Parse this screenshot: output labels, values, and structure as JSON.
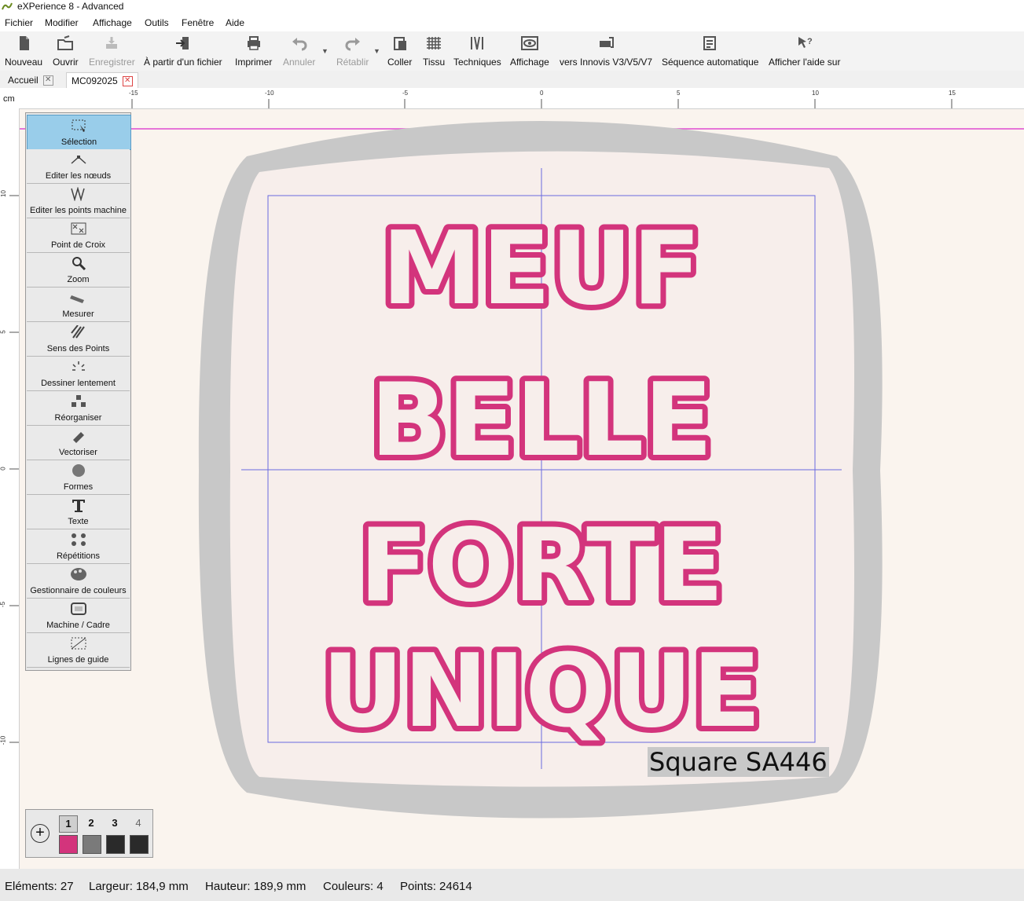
{
  "app": {
    "title": "eXPerience 8 - Advanced"
  },
  "menu": [
    "Fichier",
    "Modifier",
    "Affichage",
    "Outils",
    "Fenêtre",
    "Aide"
  ],
  "toolbar": [
    {
      "label": "Nouveau",
      "icon": "new-file-icon",
      "enabled": true
    },
    {
      "label": "Ouvrir",
      "icon": "open-folder-icon",
      "enabled": true
    },
    {
      "label": "Enregistrer",
      "icon": "save-icon",
      "enabled": false
    },
    {
      "label": "À partir d'un fichier",
      "icon": "import-file-icon",
      "enabled": true
    },
    {
      "label": "Imprimer",
      "icon": "printer-icon",
      "enabled": true
    },
    {
      "label": "Annuler",
      "icon": "undo-icon",
      "enabled": false
    },
    {
      "label": "Rétablir",
      "icon": "redo-icon",
      "enabled": false
    },
    {
      "label": "Coller",
      "icon": "paste-icon",
      "enabled": true
    },
    {
      "label": "Tissu",
      "icon": "fabric-icon",
      "enabled": true
    },
    {
      "label": "Techniques",
      "icon": "techniques-icon",
      "enabled": true
    },
    {
      "label": "Affichage",
      "icon": "eye-icon",
      "enabled": true
    },
    {
      "label": "vers Innovis V3/V5/V7",
      "icon": "machine-transfer-icon",
      "enabled": true
    },
    {
      "label": "Séquence automatique",
      "icon": "auto-sequence-icon",
      "enabled": true
    },
    {
      "label": "Afficher l'aide sur",
      "icon": "help-pointer-icon",
      "enabled": true
    }
  ],
  "tabs": [
    {
      "label": "Accueil",
      "active": false
    },
    {
      "label": "MC092025",
      "active": true
    }
  ],
  "ruler": {
    "unit": "cm",
    "top_ticks": [
      "-15",
      "-10",
      "-5",
      "0",
      "5",
      "10",
      "15"
    ],
    "left_ticks": [
      "10",
      "5",
      "0",
      "-5",
      "-10"
    ]
  },
  "tools": [
    {
      "label": "Sélection",
      "icon": "selection-icon",
      "selected": true
    },
    {
      "label": "Editer les nœuds",
      "icon": "edit-nodes-icon"
    },
    {
      "label": "Editer les points machine",
      "icon": "edit-stitches-icon"
    },
    {
      "label": "Point de Croix",
      "icon": "cross-stitch-icon"
    },
    {
      "label": "Zoom",
      "icon": "zoom-icon"
    },
    {
      "label": "Mesurer",
      "icon": "measure-icon"
    },
    {
      "label": "Sens des Points",
      "icon": "stitch-direction-icon"
    },
    {
      "label": "Dessiner lentement",
      "icon": "draw-slowly-icon"
    },
    {
      "label": "Réorganiser",
      "icon": "reorganize-icon"
    },
    {
      "label": "Vectoriser",
      "icon": "vectorize-icon"
    },
    {
      "label": "Formes",
      "icon": "shapes-icon"
    },
    {
      "label": "Texte",
      "icon": "text-icon"
    },
    {
      "label": "Répétitions",
      "icon": "repetitions-icon"
    },
    {
      "label": "Gestionnaire de couleurs",
      "icon": "color-manager-icon"
    },
    {
      "label": "Machine / Cadre",
      "icon": "machine-frame-icon"
    },
    {
      "label": "Lignes de guide",
      "icon": "guide-lines-icon"
    }
  ],
  "design": {
    "lines": [
      "MEUF",
      "BELLE",
      "FORTE",
      "UNIQUE"
    ],
    "hoop_label": "Square SA446",
    "thread_color": "#d3347c",
    "outline_color": "#a51f5c"
  },
  "colors_panel": {
    "colors": [
      {
        "num": "1",
        "swatch": "#d3347c",
        "selected": true
      },
      {
        "num": "2",
        "swatch": "#7a7a7a",
        "selected": false
      },
      {
        "num": "3",
        "swatch": "#2a2a2a",
        "selected": false
      },
      {
        "num": "4",
        "swatch": "#2a2a2a",
        "selected": false
      }
    ]
  },
  "status": {
    "elements": "Eléments: 27",
    "width": "Largeur: 184,9 mm",
    "height": "Hauteur: 189,9 mm",
    "colors": "Couleurs: 4",
    "points": "Points: 24614"
  }
}
